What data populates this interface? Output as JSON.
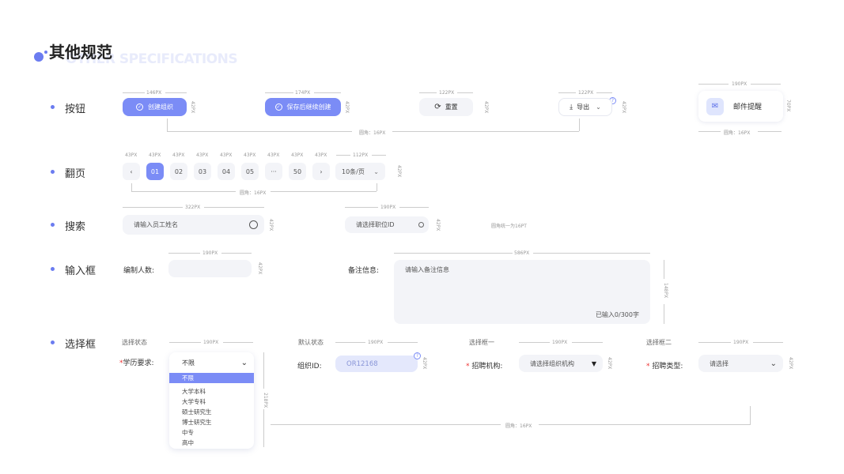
{
  "header": {
    "title": "其他规范",
    "subtitle": "OTHER SPECIFICATIONS"
  },
  "sections": {
    "buttons": {
      "label": "按钮",
      "create_label": "创建组织",
      "save_continue_label": "保存后继续创建",
      "reset_label": "重置",
      "export_label": "导出",
      "mail_label": "邮件提醒",
      "dims": {
        "w1": "146PX",
        "w2": "174PX",
        "w3": "122PX",
        "w4": "122PX",
        "w5": "190PX",
        "h1": "42PX",
        "h2": "42PX",
        "h3": "42PX",
        "h4": "42PX",
        "h5": "70PX",
        "radius": "圆角：16PX",
        "radius2": "圆角：16PX"
      }
    },
    "pagination": {
      "label": "翻页",
      "pages": [
        "01",
        "02",
        "03",
        "04",
        "05",
        "···",
        "50"
      ],
      "size_label": "10条/页",
      "widths": [
        "43PX",
        "43PX",
        "43PX",
        "43PX",
        "43PX",
        "43PX",
        "43PX",
        "43PX",
        "43PX",
        "112PX"
      ],
      "height": "42PX",
      "radius": "圆角：16PX"
    },
    "search": {
      "label": "搜索",
      "placeholder1": "请输入员工姓名",
      "placeholder2": "请选择职位ID",
      "w1": "322PX",
      "w2": "190PX",
      "h1": "42PX",
      "h2": "42PX",
      "note": "圆角统一为16PT"
    },
    "input": {
      "label": "输入框",
      "field1_label": "编制人数:",
      "field2_label": "备注信息:",
      "textarea_placeholder": "请输入备注信息",
      "counter": "已输入0/300字",
      "w1": "190PX",
      "w2": "586PX",
      "h1": "42PX",
      "h2": "148PX"
    },
    "select": {
      "label": "选择框",
      "states": [
        "选择状态",
        "默认状态",
        "选择框一",
        "选择框二"
      ],
      "widths": [
        "190PX",
        "190PX",
        "190PX",
        "190PX"
      ],
      "heights": [
        "42PX",
        "42PX",
        "42PX"
      ],
      "list_height": "218PX",
      "radius": "圆角：16PX",
      "edu_label": "学历要求:",
      "edu_value": "不限",
      "options": [
        "不限",
        "大学本科",
        "大学专科",
        "硕士研究生",
        "博士研究生",
        "中专",
        "高中"
      ],
      "org_label": "组织ID:",
      "org_value": "OR12168",
      "recruit_label": "招聘机构:",
      "recruit_placeholder": "请选择组织机构",
      "type_label": "招聘类型:",
      "type_placeholder": "请选择"
    }
  },
  "colors": {
    "accent": "#7b8cf6",
    "required": "#e33333"
  }
}
